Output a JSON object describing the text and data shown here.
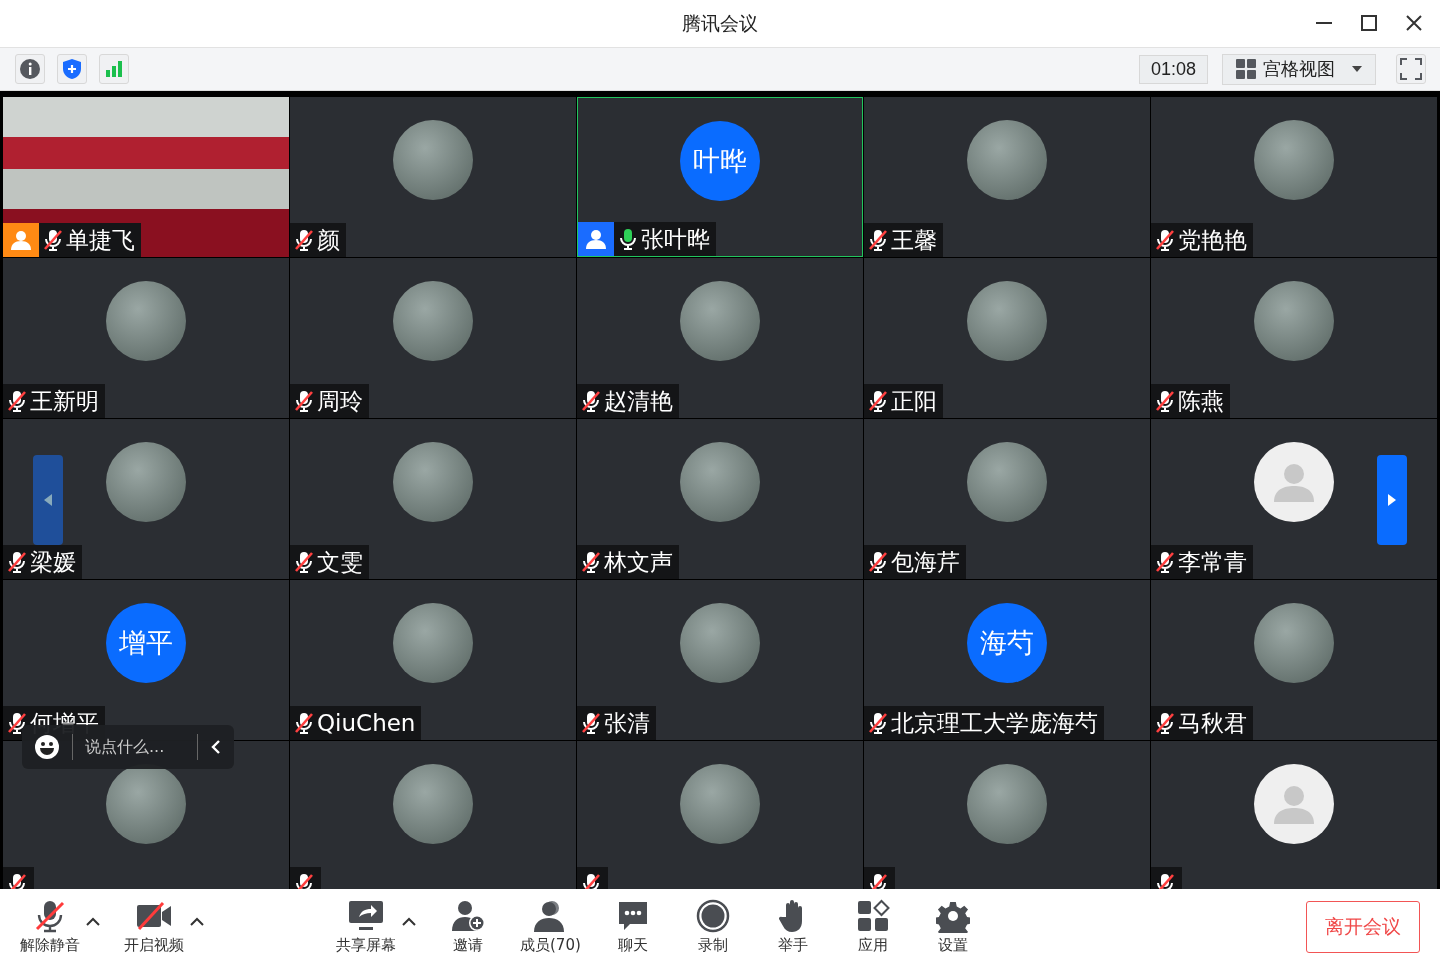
{
  "window": {
    "title": "腾讯会议"
  },
  "toolbar": {
    "timer": "01:08",
    "view_label": "宫格视图"
  },
  "participants": [
    {
      "name": "单捷飞",
      "kind": "video",
      "muted": true,
      "speaking": false,
      "badge": true,
      "color": "#ff8a14"
    },
    {
      "name": "颜",
      "kind": "photo",
      "muted": true,
      "speaking": false,
      "badge": false
    },
    {
      "name": "张叶晔",
      "kind": "initials",
      "initials": "叶晔",
      "muted": false,
      "speaking": true,
      "badge": true,
      "color": "#1a6cff"
    },
    {
      "name": "王馨",
      "kind": "photo",
      "muted": true,
      "speaking": false,
      "badge": false
    },
    {
      "name": "党艳艳",
      "kind": "photo",
      "muted": true,
      "speaking": false,
      "badge": false
    },
    {
      "name": "王新明",
      "kind": "photo",
      "muted": true,
      "speaking": false,
      "badge": false
    },
    {
      "name": "周玲",
      "kind": "photo",
      "muted": true,
      "speaking": false,
      "badge": false
    },
    {
      "name": "赵清艳",
      "kind": "photo",
      "muted": true,
      "speaking": false,
      "badge": false
    },
    {
      "name": "正阳",
      "kind": "photo",
      "muted": true,
      "speaking": false,
      "badge": false
    },
    {
      "name": "陈燕",
      "kind": "photo",
      "muted": true,
      "speaking": false,
      "badge": false
    },
    {
      "name": "梁媛",
      "kind": "photo",
      "muted": true,
      "speaking": false,
      "badge": false
    },
    {
      "name": "文雯",
      "kind": "photo",
      "muted": true,
      "speaking": false,
      "badge": false
    },
    {
      "name": "林文声",
      "kind": "photo",
      "muted": true,
      "speaking": false,
      "badge": false
    },
    {
      "name": "包海芹",
      "kind": "photo",
      "muted": true,
      "speaking": false,
      "badge": false
    },
    {
      "name": "李常青",
      "kind": "default",
      "muted": true,
      "speaking": false,
      "badge": false
    },
    {
      "name": "何增平",
      "kind": "initials",
      "initials": "增平",
      "muted": true,
      "speaking": false,
      "badge": false
    },
    {
      "name": "QiuChen",
      "kind": "photo",
      "muted": true,
      "speaking": false,
      "badge": false
    },
    {
      "name": "张清",
      "kind": "photo",
      "muted": true,
      "speaking": false,
      "badge": false
    },
    {
      "name": "北京理工大学庞海芍",
      "kind": "initials",
      "initials": "海芍",
      "muted": true,
      "speaking": false,
      "badge": false
    },
    {
      "name": "马秋君",
      "kind": "photo",
      "muted": true,
      "speaking": false,
      "badge": false
    },
    {
      "kind": "photo",
      "muted": true,
      "speaking": false,
      "badge": false
    },
    {
      "kind": "photo",
      "muted": true,
      "speaking": false,
      "badge": false
    },
    {
      "kind": "photo",
      "muted": true,
      "speaking": false,
      "badge": false
    },
    {
      "kind": "photo",
      "muted": true,
      "speaking": false,
      "badge": false
    },
    {
      "kind": "default",
      "muted": true,
      "speaking": false,
      "badge": false
    }
  ],
  "chat": {
    "placeholder": "说点什么..."
  },
  "bottom_bar": {
    "items": [
      {
        "label": "解除静音",
        "menu": true
      },
      {
        "label": "开启视频",
        "menu": true
      },
      {
        "label": "共享屏幕",
        "menu": true
      },
      {
        "label": "邀请",
        "menu": false
      },
      {
        "label": "成员(70)",
        "menu": false
      },
      {
        "label": "聊天",
        "menu": false
      },
      {
        "label": "录制",
        "menu": false
      },
      {
        "label": "举手",
        "menu": false
      },
      {
        "label": "应用",
        "menu": false
      },
      {
        "label": "设置",
        "menu": false
      }
    ],
    "leave": "离开会议"
  }
}
